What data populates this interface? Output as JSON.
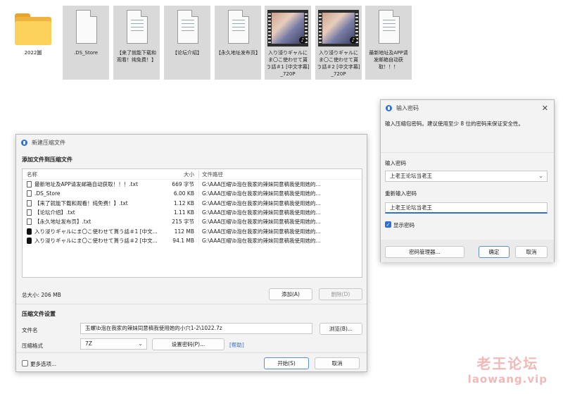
{
  "desktop": {
    "icons": [
      {
        "label": "2022圖",
        "kind": "folder"
      },
      {
        "label": ".DS_Store",
        "kind": "file"
      },
      {
        "label": "【来了就能下载和观看！纯免费！】",
        "kind": "file"
      },
      {
        "label": "【论坛介绍】",
        "kind": "file"
      },
      {
        "label": "【永久地址发布页】",
        "kind": "file"
      },
      {
        "label": "入り浸りギャルにま〇こ使わせて貰う話＃1 [中文字幕]_720P",
        "kind": "video"
      },
      {
        "label": "入り浸りギャルにま〇こ使わせて貰う話＃2 [中文字幕]_720P",
        "kind": "video"
      },
      {
        "label": "最新地址及APP请发邮箱自动获取！！！",
        "kind": "file"
      }
    ]
  },
  "archive_dialog": {
    "title": "新建压缩文件",
    "add_section": "添加文件到压缩文件",
    "columns": {
      "name": "名称",
      "size": "大小",
      "path": "文件路径"
    },
    "files": [
      {
        "name": "最新地址及APP请发邮箱自动获取！！！.txt",
        "size": "669 字节",
        "path": "G:\\AAA压缩\\b泡在我家的辣妹同意稿我使用她的...",
        "icon": "text-file-icon"
      },
      {
        "name": ".DS_Store",
        "size": "6.00 KB",
        "path": "G:\\AAA压缩\\b泡在我家的辣妹同意稿我使用她的...",
        "icon": "text-file-icon"
      },
      {
        "name": "【来了就能下载和观看！纯免费！】.txt",
        "size": "1.12 KB",
        "path": "G:\\AAA压缩\\b泡在我家的辣妹同意稿我使用她的...",
        "icon": "text-file-icon"
      },
      {
        "name": "【论坛介绍】.txt",
        "size": "1.11 KB",
        "path": "G:\\AAA压缩\\b泡在我家的辣妹同意稿我使用她的...",
        "icon": "text-file-icon"
      },
      {
        "name": "【永久地址发布页】.txt",
        "size": "215 字节",
        "path": "G:\\AAA压缩\\b泡在我家的辣妹同意稿我使用她的...",
        "icon": "text-file-icon"
      },
      {
        "name": "入り浸りギャルにま〇こ使わせて貰う話＃1 [中文...",
        "size": "112 MB",
        "path": "G:\\AAA压缩\\b泡在我家的辣妹同意稿我使用她的...",
        "icon": "video-file-icon"
      },
      {
        "name": "入り浸りギャルにま〇こ使わせて貰う話＃2 [中文...",
        "size": "94.1 MB",
        "path": "G:\\AAA压缩\\b泡在我家的辣妹同意稿我使用她的...",
        "icon": "video-file-icon"
      }
    ],
    "total_size": "总大小: 206 MB",
    "add_button": "添加(A)",
    "delete_button": "删除(D)",
    "settings_section": "压缩文件设置",
    "filename_label": "文件名",
    "filename_value": "玉螺\\b泡在我家的辣妹同意稿我使用她的小穴1-2\\1022.7z",
    "browse_button": "浏览(B)...",
    "format_label": "压缩格式",
    "format_value": "7Z",
    "set_password_button": "设置密码(P)...",
    "help_link": "[帮助]",
    "more_options": "更多选项...",
    "start_button": "开始(S)",
    "cancel_button": "取消"
  },
  "password_dialog": {
    "title": "输入密码",
    "description": "输入压缩包密码。建议使用至少 8 位的密码来保证安全性。",
    "enter_label": "输入密码",
    "enter_value": "上老王论坛当老王",
    "reenter_label": "重新输入密码",
    "reenter_value": "上老王论坛当老王",
    "show_password_label": "显示密码",
    "show_password_checked": true,
    "manager_button": "密码管理器...",
    "ok_button": "确定",
    "cancel_button": "取消"
  },
  "watermark": {
    "line1": "老王论坛",
    "line2": "laowang.vip"
  }
}
